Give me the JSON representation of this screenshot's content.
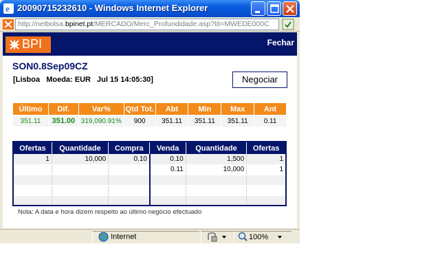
{
  "window": {
    "title": "20090715232610 - Windows Internet Explorer",
    "url_prefix": "http://netbolsa.",
    "url_host": "bpinet.pt",
    "url_path": "/MERCADO/Merc_Profundidade.asp?tit=MWEDE000C"
  },
  "header": {
    "logo_text": "BPI",
    "close_label": "Fechar"
  },
  "instrument": {
    "ticker": "SON0.8Sep09CZ",
    "market": "[Lisboa",
    "currency": "Moeda: EUR",
    "datetime": "Jul 15 14:05:30]",
    "trade_button": "Negociar"
  },
  "quote": {
    "headers": [
      "Último",
      "Dif.",
      "Var%",
      "Qtd Tot.",
      "Abt",
      "Min",
      "Max",
      "Ant"
    ],
    "values": [
      "351.11",
      "351.00",
      "319,090.91%",
      "900",
      "351.11",
      "351.11",
      "351.11",
      "0.11"
    ]
  },
  "order_book": {
    "headers": [
      "Ofertas",
      "Quantidade",
      "Compra",
      "Venda",
      "Quantidade",
      "Ofertas"
    ],
    "rows": [
      [
        "1",
        "10,000",
        "0.10",
        "0.10",
        "1,500",
        "1"
      ],
      [
        "",
        "",
        "",
        "0.11",
        "10,000",
        "1"
      ],
      [
        "",
        "",
        "",
        "",
        "",
        ""
      ],
      [
        "",
        "",
        "",
        "",
        "",
        ""
      ],
      [
        "",
        "",
        "",
        "",
        "",
        ""
      ]
    ]
  },
  "note": "Nota: A data e hora dizem respeito ao último negócio efectuado",
  "statusbar": {
    "zone": "Internet",
    "zoom": "100%"
  },
  "colors": {
    "brand_navy": "#05156a",
    "brand_orange": "#f0711b",
    "positive_green": "#1c8c1c"
  }
}
